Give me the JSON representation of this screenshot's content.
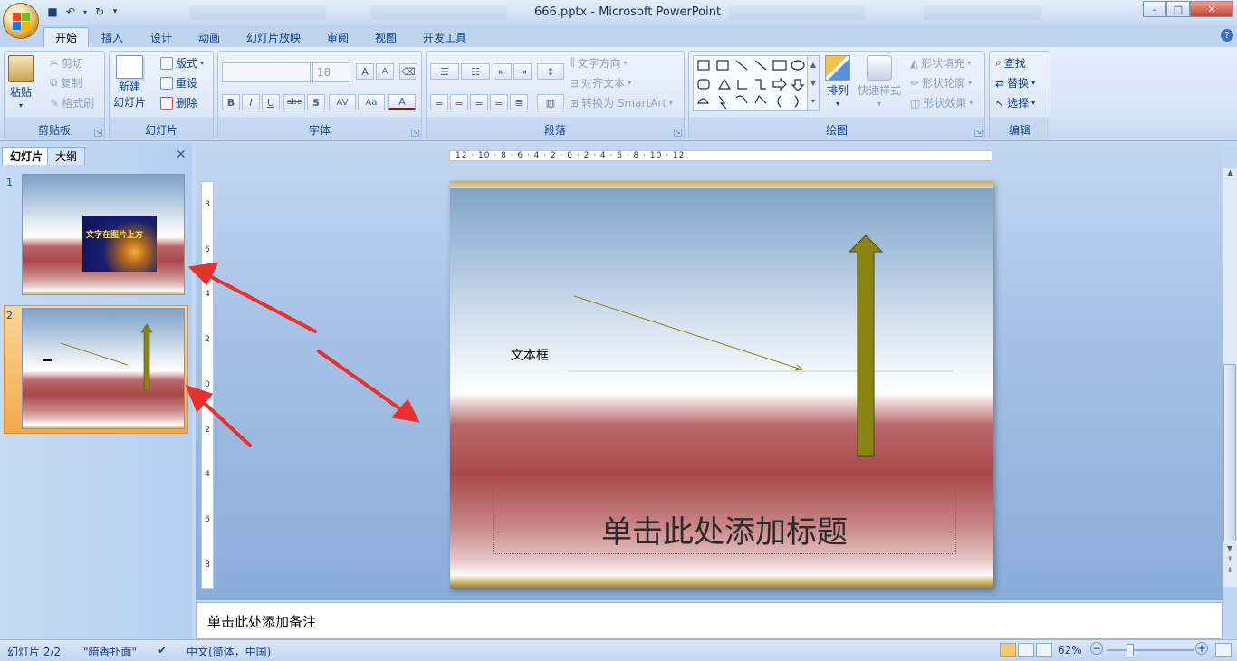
{
  "window": {
    "title": "666.pptx - Microsoft PowerPoint",
    "controls": {
      "minimize": "–",
      "maximize": "□",
      "close": "✕"
    }
  },
  "quick_access": {
    "icons": [
      "save-icon",
      "undo-icon",
      "redo-icon",
      "customize-icon"
    ]
  },
  "tabs": [
    "开始",
    "插入",
    "设计",
    "动画",
    "幻灯片放映",
    "审阅",
    "视图",
    "开发工具"
  ],
  "active_tab": "开始",
  "ribbon": {
    "clipboard": {
      "label": "剪贴板",
      "paste": "粘贴",
      "cut": "剪切",
      "copy": "复制",
      "format_painter": "格式刷"
    },
    "slides": {
      "label": "幻灯片",
      "new_slide_1": "新建",
      "new_slide_2": "幻灯片",
      "layout": "版式",
      "reset": "重设",
      "delete": "删除"
    },
    "font": {
      "label": "字体",
      "font_name": "",
      "font_size": "18",
      "bold": "B",
      "italic": "I",
      "underline": "U",
      "strike": "abc",
      "shadow": "S",
      "spacing": "AV",
      "case": "Aa",
      "color": "A",
      "grow": "A",
      "shrink": "A"
    },
    "paragraph": {
      "label": "段落",
      "text_direction": "文字方向",
      "align_text": "对齐文本",
      "smartart": "转换为 SmartArt"
    },
    "drawing": {
      "label": "绘图",
      "arrange": "排列",
      "quick_styles": "快速样式",
      "shape_fill": "形状填充",
      "shape_outline": "形状轮廓",
      "shape_effects": "形状效果"
    },
    "editing": {
      "label": "编辑",
      "find": "查找",
      "replace": "替换",
      "select": "选择"
    }
  },
  "panel": {
    "tabs": [
      "幻灯片",
      "大纲"
    ],
    "close": "✕",
    "slides": [
      {
        "number": "1",
        "image_caption": "文字在图片上方"
      },
      {
        "number": "2"
      }
    ]
  },
  "ruler": {
    "horizontal": "12 · 10 · 8 · 6 · 4 · 2 · 0 · 2 · 4 · 6 · 8 · 10 · 12",
    "vertical": [
      "8",
      "6",
      "4",
      "2",
      "0",
      "2",
      "4",
      "6",
      "8"
    ]
  },
  "slide": {
    "textbox": "文本框",
    "title_placeholder": "单击此处添加标题",
    "arrow_color": "#8a8413"
  },
  "notes": {
    "placeholder": "单击此处添加备注"
  },
  "status": {
    "slide_index": "幻灯片 2/2",
    "theme": "\"暗香扑面\"",
    "language": "中文(简体，中国)",
    "zoom": "62%",
    "zoom_minus": "−",
    "zoom_plus": "+"
  },
  "annotation_color": "#e8302c"
}
